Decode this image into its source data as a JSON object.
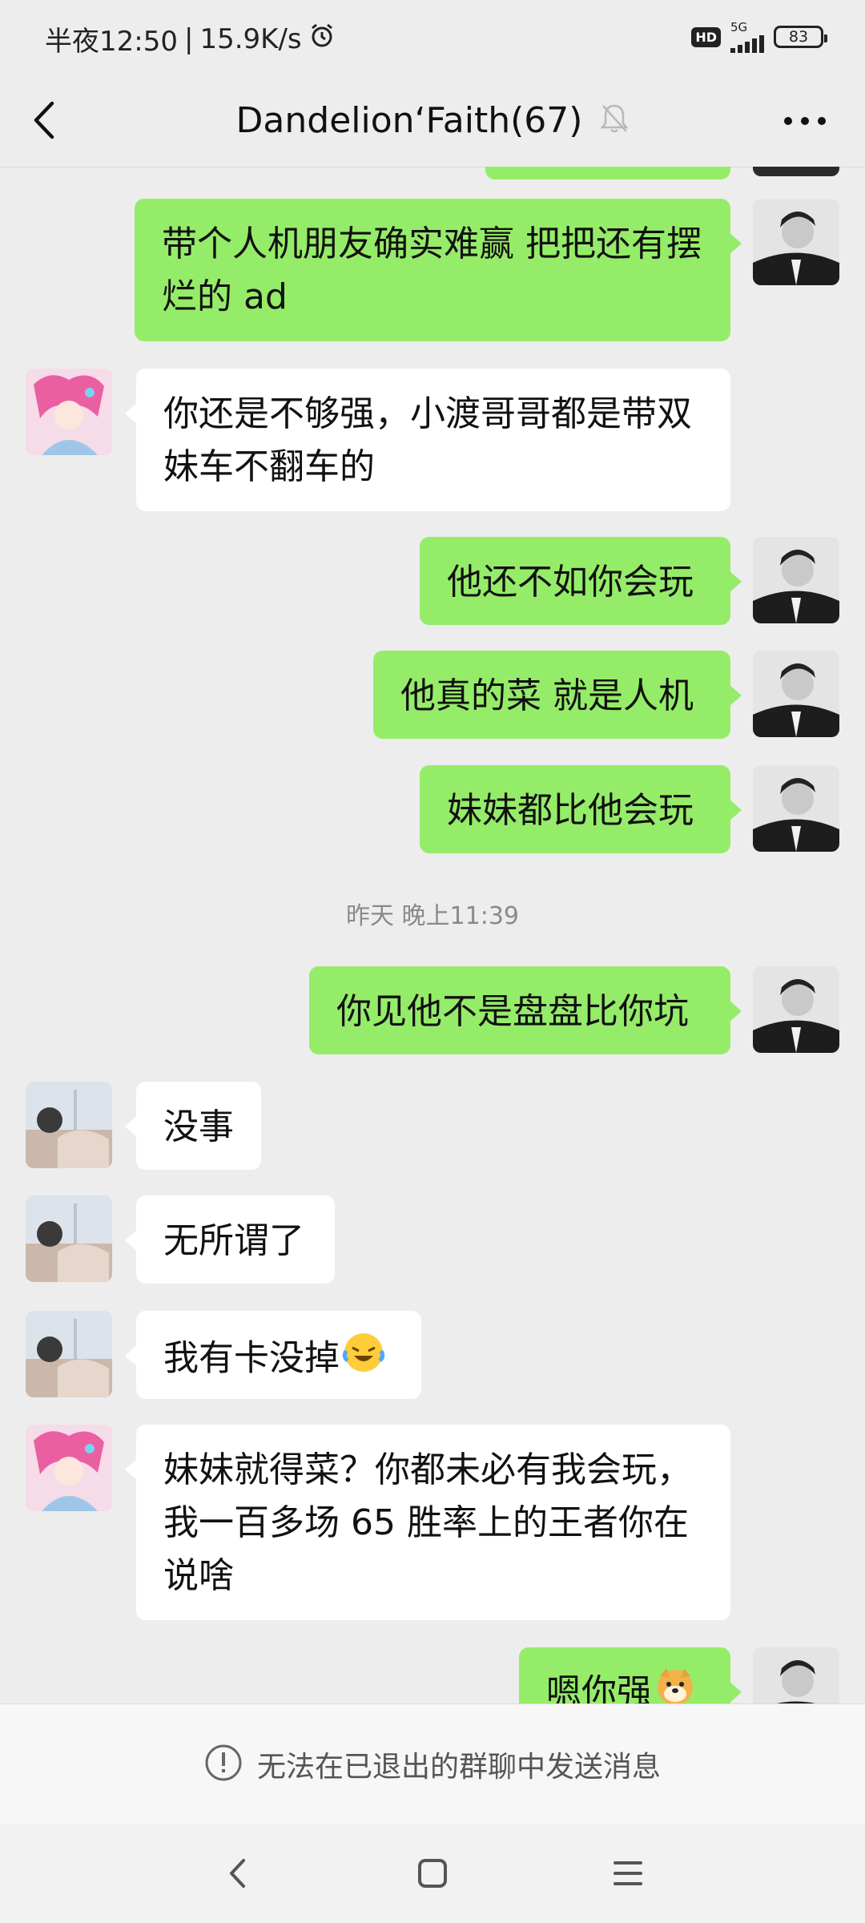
{
  "status_bar": {
    "time": "半夜12:50",
    "speed": "15.9K/s",
    "network": "5G",
    "hd": "HD",
    "battery": "83"
  },
  "header": {
    "title": "Dandelion‘Faith(67)"
  },
  "messages": [
    {
      "side": "me",
      "text": "带个人机朋友确实难赢 把把还有摆烂的 ad"
    },
    {
      "side": "her",
      "text": "你还是不够强，小渡哥哥都是带双妹车不翻车的"
    },
    {
      "side": "me",
      "text": "他还不如你会玩"
    },
    {
      "side": "me",
      "text": "他真的菜 就是人机"
    },
    {
      "side": "me",
      "text": "妹妹都比他会玩"
    },
    {
      "side": "me",
      "text": "你见他不是盘盘比你坑"
    },
    {
      "side": "him",
      "text": "没事"
    },
    {
      "side": "him",
      "text": "无所谓了"
    },
    {
      "side": "him",
      "text": "我有卡没掉"
    },
    {
      "side": "her",
      "text": "妹妹就得菜？你都未必有我会玩，我一百多场 65 胜率上的王者你在说啥"
    },
    {
      "side": "me",
      "text": "嗯你强"
    }
  ],
  "timestamp": "昨天 晚上11:39",
  "notice": {
    "text": "无法在已退出的群聊中发送消息"
  },
  "colors": {
    "my_bubble": "#95ec69",
    "other_bubble": "#ffffff",
    "background": "#ededed"
  }
}
